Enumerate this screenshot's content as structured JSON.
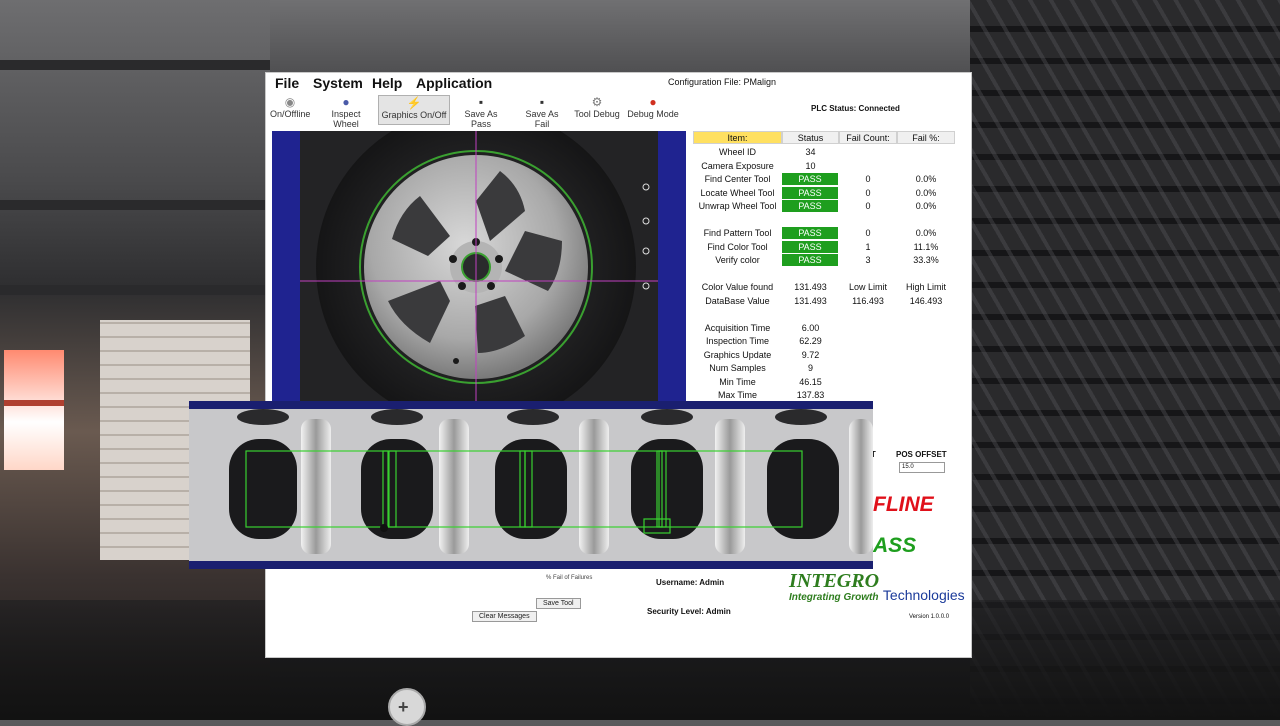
{
  "menu": {
    "file": "File",
    "system": "System",
    "help": "Help",
    "application": "Application"
  },
  "config_file": "Configuration File: PMalign",
  "plc_status": "PLC Status: Connected",
  "toolbar": {
    "online": "On/Offline",
    "inspect": "Inspect Wheel",
    "graphics": "Graphics On/Off",
    "save_pass": "Save As Pass",
    "save_fail": "Save As Fail",
    "tool_debug": "Tool Debug",
    "debug_mode": "Debug Mode"
  },
  "table": {
    "headers": {
      "item": "Item:",
      "status": "Status",
      "fail_count": "Fail Count:",
      "fail_pct": "Fail %:"
    },
    "wheel_id": {
      "label": "Wheel ID",
      "value": "34"
    },
    "camera_exposure": {
      "label": "Camera Exposure",
      "value": "10"
    },
    "rows": [
      {
        "label": "Find Center Tool",
        "status": "PASS",
        "count": "0",
        "pct": "0.0%"
      },
      {
        "label": "Locate Wheel Tool",
        "status": "PASS",
        "count": "0",
        "pct": "0.0%"
      },
      {
        "label": "Unwrap Wheel Tool",
        "status": "PASS",
        "count": "0",
        "pct": "0.0%"
      },
      {
        "label": "Find Pattern Tool",
        "status": "PASS",
        "count": "0",
        "pct": "0.0%"
      },
      {
        "label": "Find Color Tool",
        "status": "PASS",
        "count": "1",
        "pct": "11.1%"
      },
      {
        "label": "Verify color",
        "status": "PASS",
        "count": "3",
        "pct": "33.3%"
      }
    ],
    "color_found": {
      "label": "Color Value found",
      "value": "131.493",
      "low_label": "Low Limit",
      "high_label": "High Limit"
    },
    "db_value": {
      "label": "DataBase Value",
      "value": "131.493",
      "low": "116.493",
      "high": "146.493"
    },
    "timing": [
      {
        "label": "Acquisition Time",
        "value": "6.00"
      },
      {
        "label": "Inspection Time",
        "value": "62.29"
      },
      {
        "label": "Graphics Update",
        "value": "9.72"
      },
      {
        "label": "Num Samples",
        "value": "9"
      },
      {
        "label": "Min Time",
        "value": "46.15"
      },
      {
        "label": "Max Time",
        "value": "137.83"
      }
    ]
  },
  "lower": {
    "pos_offset_label": "POS OFFSET",
    "pos_offset_partial": "FT",
    "pos_offset_value": "15.0",
    "offline_partial": "FLINE",
    "pass_partial": "ASS",
    "fail_pct_label": "% Fail of Failures",
    "username": "Username: Admin",
    "security": "Security Level: Admin",
    "save_tool": "Save Tool",
    "clear_messages": "Clear Messages",
    "version": "Version 1.0.0.0"
  },
  "logo": {
    "name": "INTEGRO",
    "tagline": "Integrating Growth",
    "suffix": "Technologies"
  },
  "colors": {
    "pass_green": "#1e9e1e",
    "header_yellow": "#ffe060",
    "offline_red": "#e0101a",
    "pass_big_green": "#1e9e1e",
    "camera_blue": "#1f2390"
  }
}
